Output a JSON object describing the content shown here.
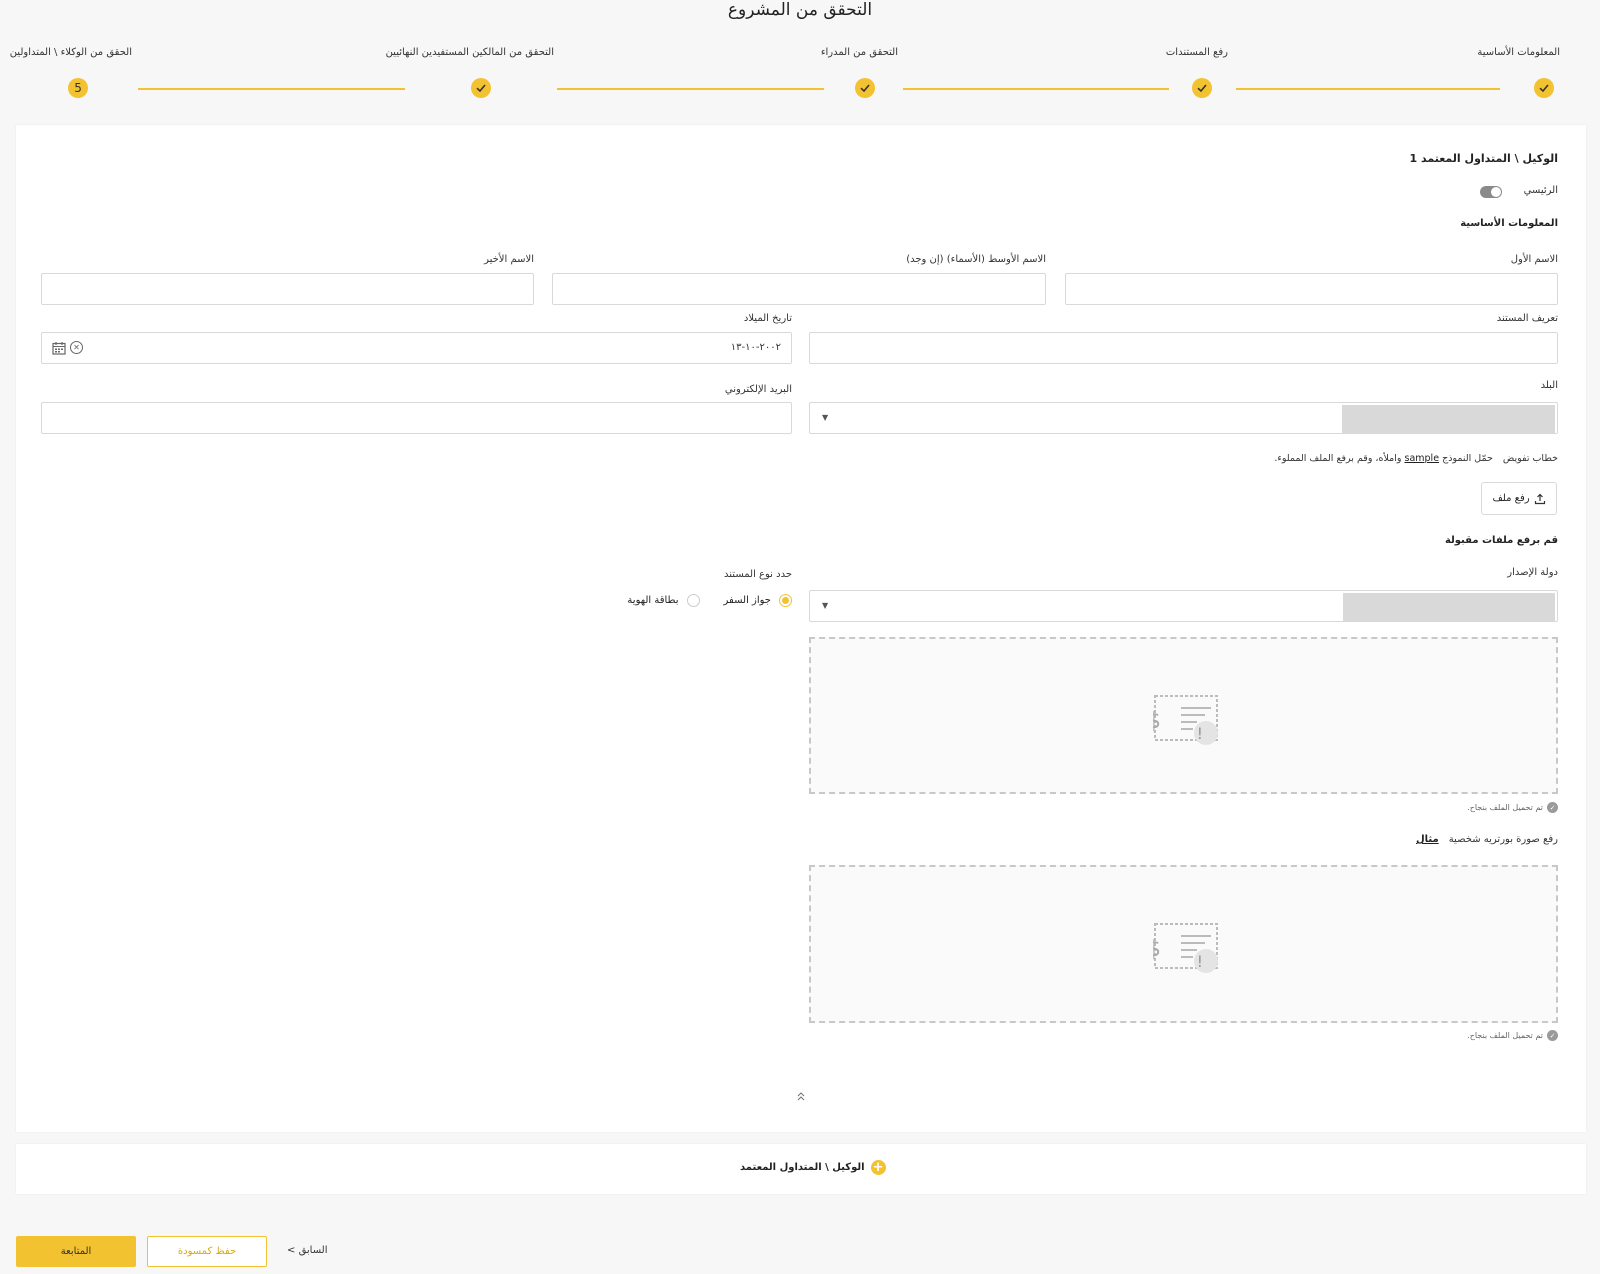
{
  "page": {
    "title": "التحقق من المشروع"
  },
  "stepper": {
    "steps": [
      {
        "label": "المعلومات الأساسية",
        "status": "done"
      },
      {
        "label": "رفع المستندات",
        "status": "done"
      },
      {
        "label": "التحقق من المدراء",
        "status": "done"
      },
      {
        "label": "التحقق من المالكين المستفيدين النهائيين",
        "status": "done"
      },
      {
        "label": "الحقق من الوكلاء \\ المتداولين",
        "status": "current",
        "number": "5"
      }
    ]
  },
  "agent": {
    "section_title": "الوكيل \\ المتداول المعتمد 1",
    "primary_toggle_label": "الرئيسي",
    "primary_toggle_on": true,
    "basic_info_title": "المعلومات الأساسية",
    "first_name": {
      "label": "الاسم الأول",
      "value": ""
    },
    "middle_name": {
      "label": "الاسم الأوسط (الأسماء) (إن وجد)",
      "value": ""
    },
    "last_name": {
      "label": "الاسم الأخير",
      "value": ""
    },
    "user_id": {
      "label": "تعريف المستند",
      "value": ""
    },
    "birth_date": {
      "label": "تاريخ الميلاد",
      "value": "٢٠٠٢-١٠-١٣"
    },
    "country": {
      "label": "البلد",
      "value": ""
    },
    "email": {
      "label": "البريد الإلكتروني",
      "value": ""
    },
    "authorization": {
      "label": "خطاب تفويض",
      "hint_before": "حمّل النموذج",
      "sample_link": "sample",
      "hint_after": "واملأه، وقم برفع الملف المملوء.",
      "upload_button": "رفع ملف"
    },
    "accepted_files_title": "قم برفع ملفات مقبولة",
    "issuing_country": {
      "label": "دولة الإصدار",
      "value": ""
    },
    "document_type": {
      "label": "حدد نوع المستند",
      "options": [
        "جواز السفر",
        "بطاقة الهوية"
      ],
      "selected": "جواز السفر"
    },
    "upload_success_text": "تم تحميل الملف بنجاح.",
    "portrait": {
      "label": "رفع صورة بورتريه شخصية",
      "example_link": "مثال"
    }
  },
  "add_agent": {
    "label": "الوكيل \\ المتداول المعتمد"
  },
  "footer": {
    "continue_button": "المتابعة",
    "save_draft_button": "حفظ كمسودة",
    "back_link": "< السابق"
  },
  "colors": {
    "accent": "#f2c230",
    "background": "#f7f7f7",
    "card": "#ffffff"
  },
  "icons": [
    "check-icon",
    "calendar-icon",
    "clear-icon",
    "upload-icon",
    "dropdown-caret-icon",
    "document-placeholder-icon",
    "success-check-icon",
    "collapse-chevrons-icon",
    "plus-icon"
  ]
}
